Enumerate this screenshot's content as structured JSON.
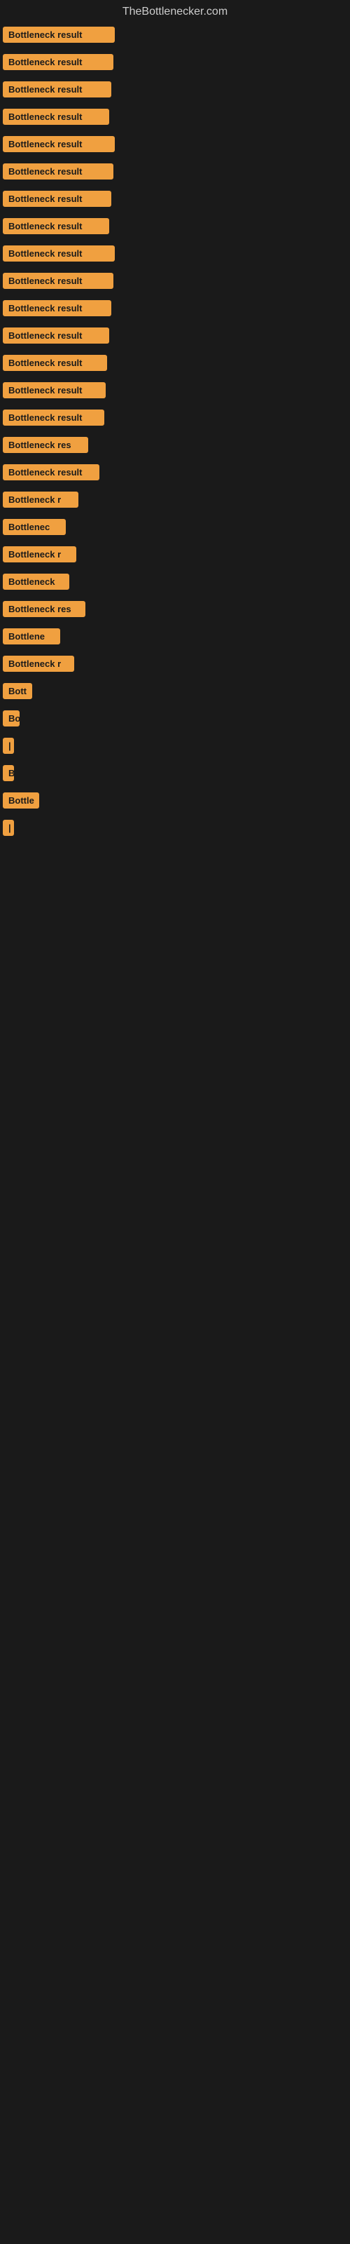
{
  "site_title": "TheBottlenecker.com",
  "items": [
    {
      "label": "Bottleneck result",
      "width": 160
    },
    {
      "label": "Bottleneck result",
      "width": 158
    },
    {
      "label": "Bottleneck result",
      "width": 155
    },
    {
      "label": "Bottleneck result",
      "width": 152
    },
    {
      "label": "Bottleneck result",
      "width": 160
    },
    {
      "label": "Bottleneck result",
      "width": 158
    },
    {
      "label": "Bottleneck result",
      "width": 155
    },
    {
      "label": "Bottleneck result",
      "width": 152
    },
    {
      "label": "Bottleneck result",
      "width": 160
    },
    {
      "label": "Bottleneck result",
      "width": 158
    },
    {
      "label": "Bottleneck result",
      "width": 155
    },
    {
      "label": "Bottleneck result",
      "width": 152
    },
    {
      "label": "Bottleneck result",
      "width": 149
    },
    {
      "label": "Bottleneck result",
      "width": 147
    },
    {
      "label": "Bottleneck result",
      "width": 145
    },
    {
      "label": "Bottleneck res",
      "width": 122
    },
    {
      "label": "Bottleneck result",
      "width": 138
    },
    {
      "label": "Bottleneck r",
      "width": 108
    },
    {
      "label": "Bottlenec",
      "width": 90
    },
    {
      "label": "Bottleneck r",
      "width": 105
    },
    {
      "label": "Bottleneck",
      "width": 95
    },
    {
      "label": "Bottleneck res",
      "width": 118
    },
    {
      "label": "Bottlene",
      "width": 82
    },
    {
      "label": "Bottleneck r",
      "width": 102
    },
    {
      "label": "Bott",
      "width": 42
    },
    {
      "label": "Bo",
      "width": 24
    },
    {
      "label": "|",
      "width": 10
    },
    {
      "label": "B",
      "width": 14
    },
    {
      "label": "Bottle",
      "width": 52
    },
    {
      "label": "|",
      "width": 10
    }
  ]
}
